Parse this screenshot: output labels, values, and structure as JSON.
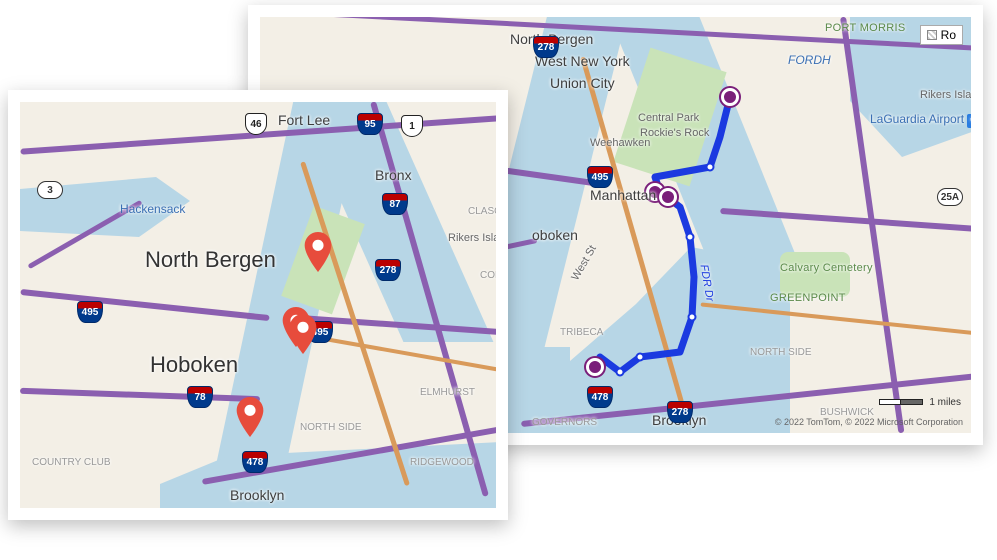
{
  "back_map": {
    "labels": {
      "north_bergen": "North Bergen",
      "west_new_york": "West New York",
      "union_city": "Union City",
      "weehawken": "Weehawken",
      "manhattan": "Manhattan",
      "oboken": "oboken",
      "brooklyn": "Brooklyn",
      "tribeca": "TRIBECA",
      "greenpoint": "GREENPOINT",
      "north_side": "NORTH SIDE",
      "bushwick": "BUSHWICK",
      "governors": "GOVERNORS",
      "west_st": "West St",
      "central_park": "Central Park",
      "rockies_rock": "Rockie's Rock",
      "rikers_island": "Rikers Island",
      "calvary_cemetery": "Calvary Cemetery",
      "laguardia": "LaGuardia Airport",
      "port_morris": "PORT MORRIS",
      "fordh": "FORDH",
      "route_label": "FDR Dr"
    },
    "shields": {
      "i278_w": "278",
      "i495": "495",
      "i478": "478",
      "i278_e": "278",
      "ny25a": "25A"
    },
    "control_label": "Ro",
    "scale_label": "1 miles",
    "attribution": "© 2022 TomTom, © 2022 Microsoft Corporation"
  },
  "front_map": {
    "labels": {
      "fort_lee": "Fort Lee",
      "bronx": "Bronx",
      "north_bergen": "North Bergen",
      "hoboken": "Hoboken",
      "brooklyn": "Brooklyn",
      "hackensack": "Hackensack",
      "rikers_island": "Rikers Island",
      "elmhurst": "ELMHURST",
      "north_side": "NORTH SIDE",
      "ridgewood": "RIDGEWOOD",
      "country_club": "COUNTRY CLUB",
      "claso": "CLASO",
      "col": "COL"
    },
    "shields": {
      "us46": "46",
      "i95": "95",
      "us1": "1",
      "ny3": "3",
      "i87": "87",
      "i278": "278",
      "i495_w": "495",
      "i495_e": "495",
      "i78": "78",
      "i478": "478"
    }
  }
}
